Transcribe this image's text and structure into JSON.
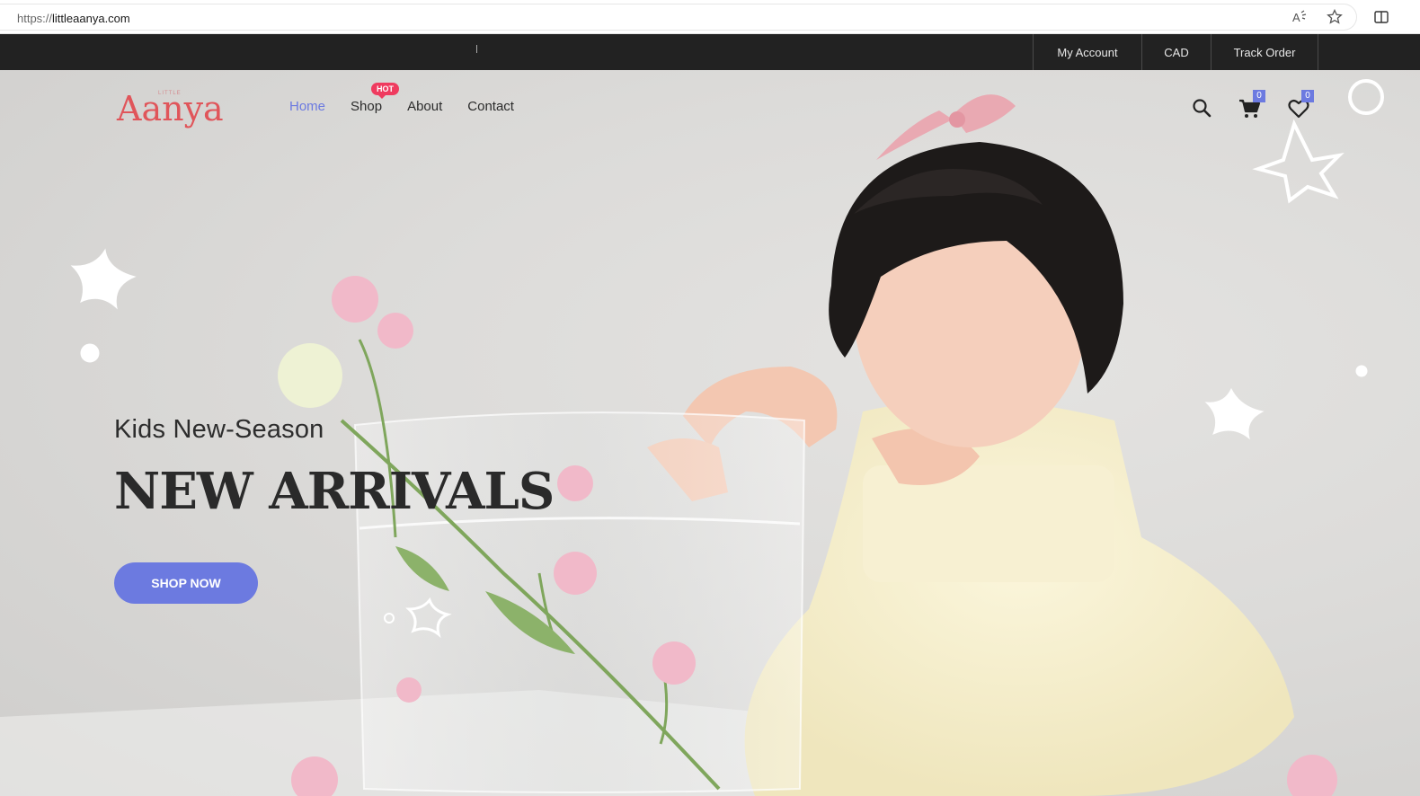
{
  "browser": {
    "url_scheme": "https://",
    "url_host": "littleaanya.com"
  },
  "topbar": {
    "items": [
      "My Account",
      "CAD",
      "Track Order"
    ]
  },
  "header": {
    "logo_small": "LITTLE",
    "logo_main": "Aanya",
    "nav": [
      {
        "label": "Home",
        "active": true
      },
      {
        "label": "Shop",
        "badge": "HOT"
      },
      {
        "label": "About"
      },
      {
        "label": "Contact"
      }
    ],
    "cart_count": "0",
    "wishlist_count": "0"
  },
  "hero": {
    "eyebrow": "Kids New-Season",
    "headline": "NEW ARRIVALS",
    "cta": "SHOP NOW"
  },
  "colors": {
    "accent": "#6c7ae0",
    "hot": "#ef3b5f",
    "logo": "#e0555a",
    "topbar": "#222222"
  },
  "icons": [
    "read-aloud-icon",
    "favorite-star-icon",
    "split-screen-icon",
    "search-icon",
    "cart-icon",
    "heart-icon"
  ]
}
